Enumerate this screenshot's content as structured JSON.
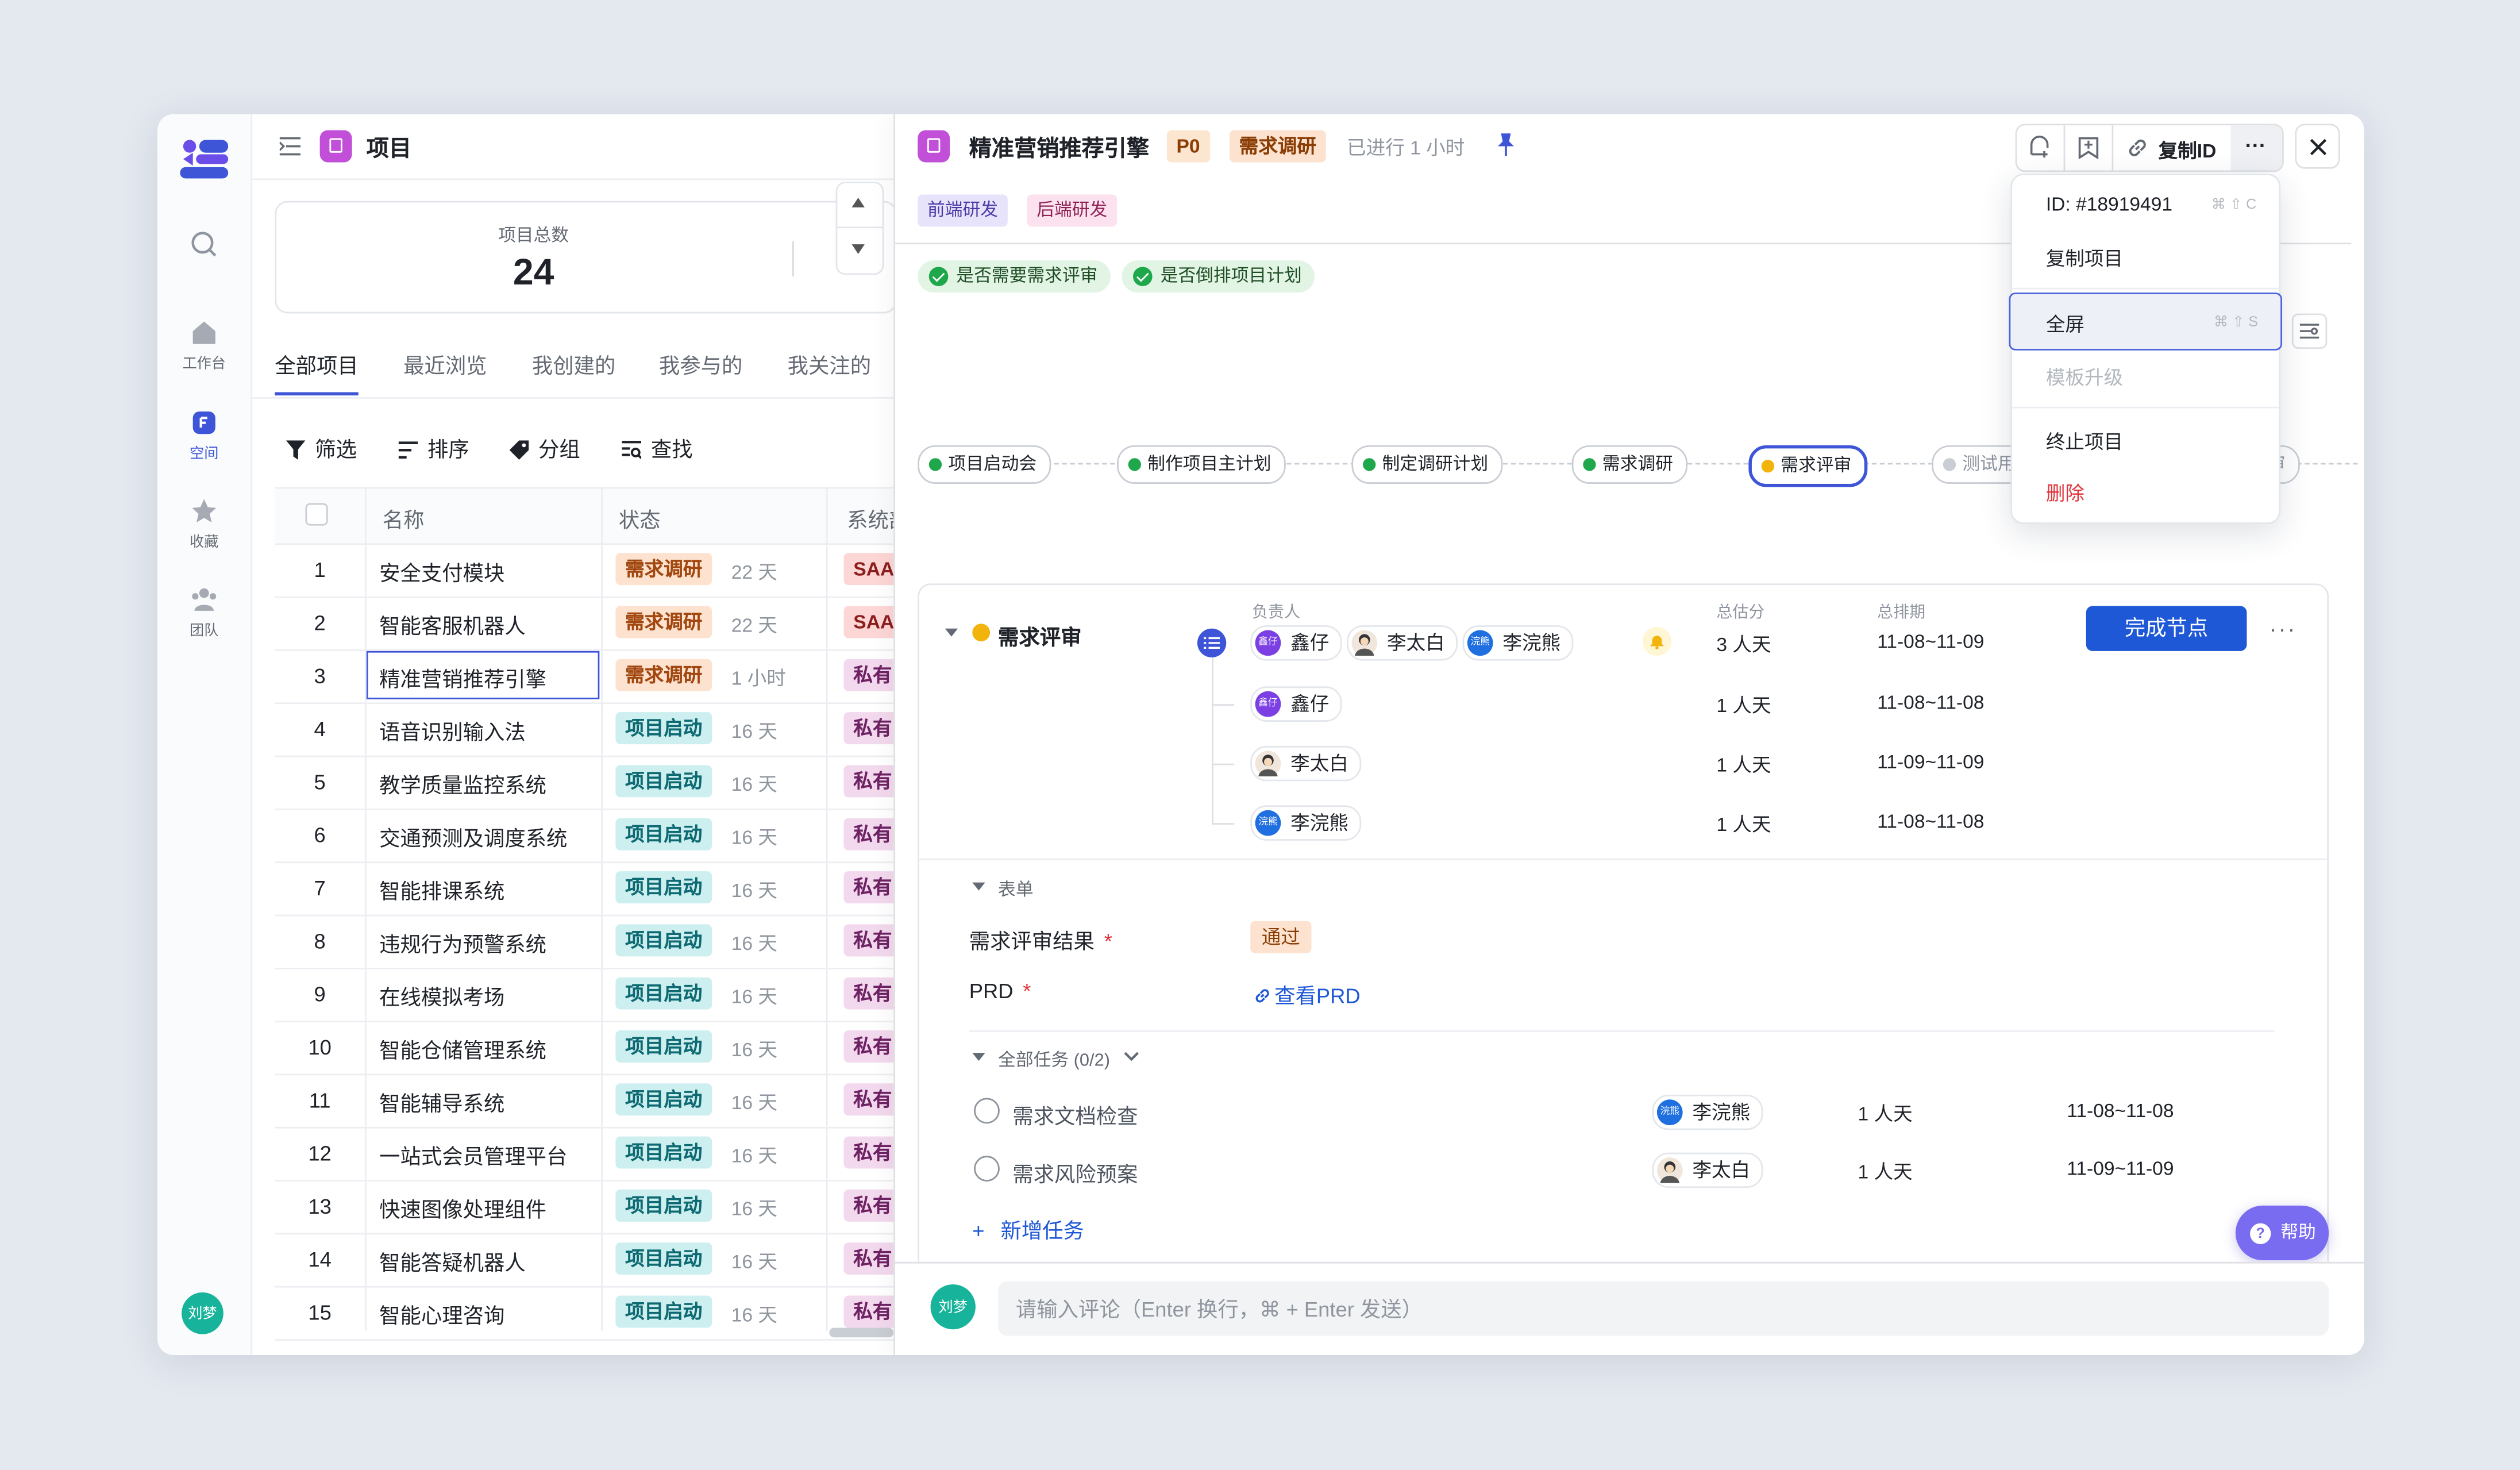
{
  "left_rail": {
    "items": [
      {
        "label": "",
        "icon": "search-icon"
      },
      {
        "label": "工作台",
        "icon": "home-icon"
      },
      {
        "label": "空间",
        "icon": "space-icon",
        "active": true
      },
      {
        "label": "收藏",
        "icon": "star-icon"
      },
      {
        "label": "团队",
        "icon": "team-icon"
      }
    ],
    "user_avatar": "刘梦"
  },
  "project_list": {
    "title": "项目",
    "summary": {
      "label": "项目总数",
      "value": "24"
    },
    "tabs": [
      "全部项目",
      "最近浏览",
      "我创建的",
      "我参与的",
      "我关注的"
    ],
    "active_tab": "全部项目",
    "toolbar": [
      "筛选",
      "排序",
      "分组",
      "查找"
    ],
    "columns": [
      "名称",
      "状态",
      "系统部"
    ],
    "rows": [
      {
        "idx": "1",
        "name": "安全支付模块",
        "status": "需求调研",
        "dur": "22 天",
        "sys": "SAAS",
        "st": "research",
        "sy": "saas"
      },
      {
        "idx": "2",
        "name": "智能客服机器人",
        "status": "需求调研",
        "dur": "22 天",
        "sys": "SAAS",
        "st": "research",
        "sy": "saas"
      },
      {
        "idx": "3",
        "name": "精准营销推荐引擎",
        "status": "需求调研",
        "dur": "1 小时",
        "sys": "私有",
        "st": "research",
        "sy": "priv",
        "selected": true
      },
      {
        "idx": "4",
        "name": "语音识别输入法",
        "status": "项目启动",
        "dur": "16 天",
        "sys": "私有",
        "st": "start",
        "sy": "priv"
      },
      {
        "idx": "5",
        "name": "教学质量监控系统",
        "status": "项目启动",
        "dur": "16 天",
        "sys": "私有",
        "st": "start",
        "sy": "priv"
      },
      {
        "idx": "6",
        "name": "交通预测及调度系统",
        "status": "项目启动",
        "dur": "16 天",
        "sys": "私有",
        "st": "start",
        "sy": "priv"
      },
      {
        "idx": "7",
        "name": "智能排课系统",
        "status": "项目启动",
        "dur": "16 天",
        "sys": "私有",
        "st": "start",
        "sy": "priv"
      },
      {
        "idx": "8",
        "name": "违规行为预警系统",
        "status": "项目启动",
        "dur": "16 天",
        "sys": "私有",
        "st": "start",
        "sy": "priv"
      },
      {
        "idx": "9",
        "name": "在线模拟考场",
        "status": "项目启动",
        "dur": "16 天",
        "sys": "私有",
        "st": "start",
        "sy": "priv"
      },
      {
        "idx": "10",
        "name": "智能仓储管理系统",
        "status": "项目启动",
        "dur": "16 天",
        "sys": "私有",
        "st": "start",
        "sy": "priv"
      },
      {
        "idx": "11",
        "name": "智能辅导系统",
        "status": "项目启动",
        "dur": "16 天",
        "sys": "私有",
        "st": "start",
        "sy": "priv"
      },
      {
        "idx": "12",
        "name": "一站式会员管理平台",
        "status": "项目启动",
        "dur": "16 天",
        "sys": "私有",
        "st": "start",
        "sy": "priv"
      },
      {
        "idx": "13",
        "name": "快速图像处理组件",
        "status": "项目启动",
        "dur": "16 天",
        "sys": "私有",
        "st": "start",
        "sy": "priv"
      },
      {
        "idx": "14",
        "name": "智能答疑机器人",
        "status": "项目启动",
        "dur": "16 天",
        "sys": "私有",
        "st": "start",
        "sy": "priv"
      },
      {
        "idx": "15",
        "name": "智能心理咨询",
        "status": "项目启动",
        "dur": "16 天",
        "sys": "私有",
        "st": "start",
        "sy": "priv"
      }
    ]
  },
  "detail": {
    "title": "精准营销推荐引擎",
    "priority": "P0",
    "status": "需求调研",
    "elapsed": "已进行 1 小时",
    "copy_id_label": "复制ID",
    "teams": [
      "前端研发",
      "后端研发"
    ],
    "checks": [
      "是否需要需求评审",
      "是否倒排项目计划"
    ],
    "pipeline": [
      {
        "label": "项目启动会",
        "state": "done"
      },
      {
        "label": "制作项目主计划",
        "state": "done"
      },
      {
        "label": "制定调研计划",
        "state": "done"
      },
      {
        "label": "需求调研",
        "state": "done"
      },
      {
        "label": "需求评审",
        "state": "current"
      },
      {
        "label": "测试用",
        "state": "todo"
      },
      {
        "label": "审",
        "state": "todo"
      }
    ],
    "node": {
      "title": "需求评审",
      "col_owner": "负责人",
      "col_estimate": "总估分",
      "col_schedule": "总排期",
      "owners": [
        "鑫仔",
        "李太白",
        "李浣熊"
      ],
      "avatar_text": {
        "x": "鑫仔",
        "h": "浣熊"
      },
      "total_estimate": "3 人天",
      "total_schedule": "11-08~11-09",
      "complete_label": "完成节点",
      "assignees": [
        {
          "name": "鑫仔",
          "estimate": "1 人天",
          "schedule": "11-08~11-08"
        },
        {
          "name": "李太白",
          "estimate": "1 人天",
          "schedule": "11-09~11-09"
        },
        {
          "name": "李浣熊",
          "estimate": "1 人天",
          "schedule": "11-08~11-08"
        }
      ],
      "form_section": "表单",
      "form": {
        "result_label": "需求评审结果",
        "result_value": "通过",
        "prd_label": "PRD",
        "prd_link": "查看PRD",
        "required_mark": "*"
      },
      "tasks_section": "全部任务 (0/2)",
      "tasks": [
        {
          "name": "需求文档检查",
          "owner": "李浣熊",
          "estimate": "1 人天",
          "schedule": "11-08~11-08"
        },
        {
          "name": "需求风险预案",
          "owner": "李太白",
          "estimate": "1 人天",
          "schedule": "11-09~11-09"
        }
      ],
      "add_task": "新增任务"
    },
    "help": "帮助",
    "comment_placeholder": "请输入评论（Enter 换行，⌘ + Enter 发送）",
    "comment_avatar": "刘梦"
  },
  "menu": {
    "items": [
      {
        "label": "ID: #18919491",
        "shortcut": "⌘ ⇧ C"
      },
      {
        "label": "复制项目",
        "shortcut": ""
      },
      {
        "label": "全屏",
        "shortcut": "⌘ ⇧ S"
      },
      {
        "label": "模板升级",
        "shortcut": ""
      },
      {
        "label": "终止项目",
        "shortcut": ""
      },
      {
        "label": "删除",
        "shortcut": ""
      }
    ]
  },
  "colors": {
    "accent": "#3e55d8",
    "primary_button": "#1f58d6",
    "project_icon": "#c14fd8",
    "danger": "#e0343b"
  }
}
